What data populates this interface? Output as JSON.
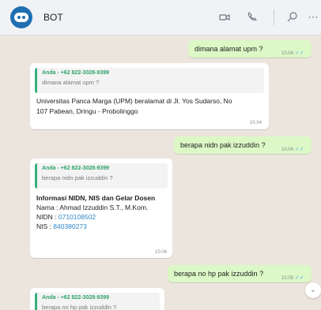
{
  "header": {
    "title": "BOT",
    "icons": [
      "video-call-icon",
      "voice-call-icon",
      "search-icon",
      "more-icon"
    ]
  },
  "messages": [
    {
      "type": "out",
      "text": "dimana alamat upm ?",
      "time": "10.04"
    },
    {
      "type": "in",
      "quote_sender": "Anda - +62 822-3028-9399",
      "quote_text": "dimana alamat upm ?",
      "lines": [
        "Universitas Panca Marga (UPM) beralamat di Jl. Yos Sudarso, No",
        "107 Pabean, Dringu - Probolinggo"
      ],
      "time": "10.04"
    },
    {
      "type": "out",
      "text": "berapa nidn pak izzuddin ?",
      "time": "10.04"
    },
    {
      "type": "in",
      "quote_sender": "Anda - +62 822-3028-9399",
      "quote_text": "berapa nidn pak izzuddin ?",
      "heading": "Informasi NIDN, NIS dan Gelar Dosen",
      "nama_label": "Nama  : ",
      "nama_value": "Ahmad Izzuddin S.T., M.Kom.",
      "nidn_label": "NIDN  : ",
      "nidn_value": "0710108502",
      "nis_label": "NIS    : ",
      "nis_value": "840380273",
      "time": "10.04"
    },
    {
      "type": "out",
      "text": "berapa no hp pak izzuddin ?",
      "time": "10.05"
    },
    {
      "type": "in",
      "quote_sender": "Anda - +62 822-3028-9399",
      "quote_text": "berapa no hp pak izzuddin ?"
    }
  ],
  "colors": {
    "accent": "#2ea36a",
    "outgoing": "#dcf8c6",
    "link": "#2c87c7",
    "tick": "#4fb6ec"
  }
}
